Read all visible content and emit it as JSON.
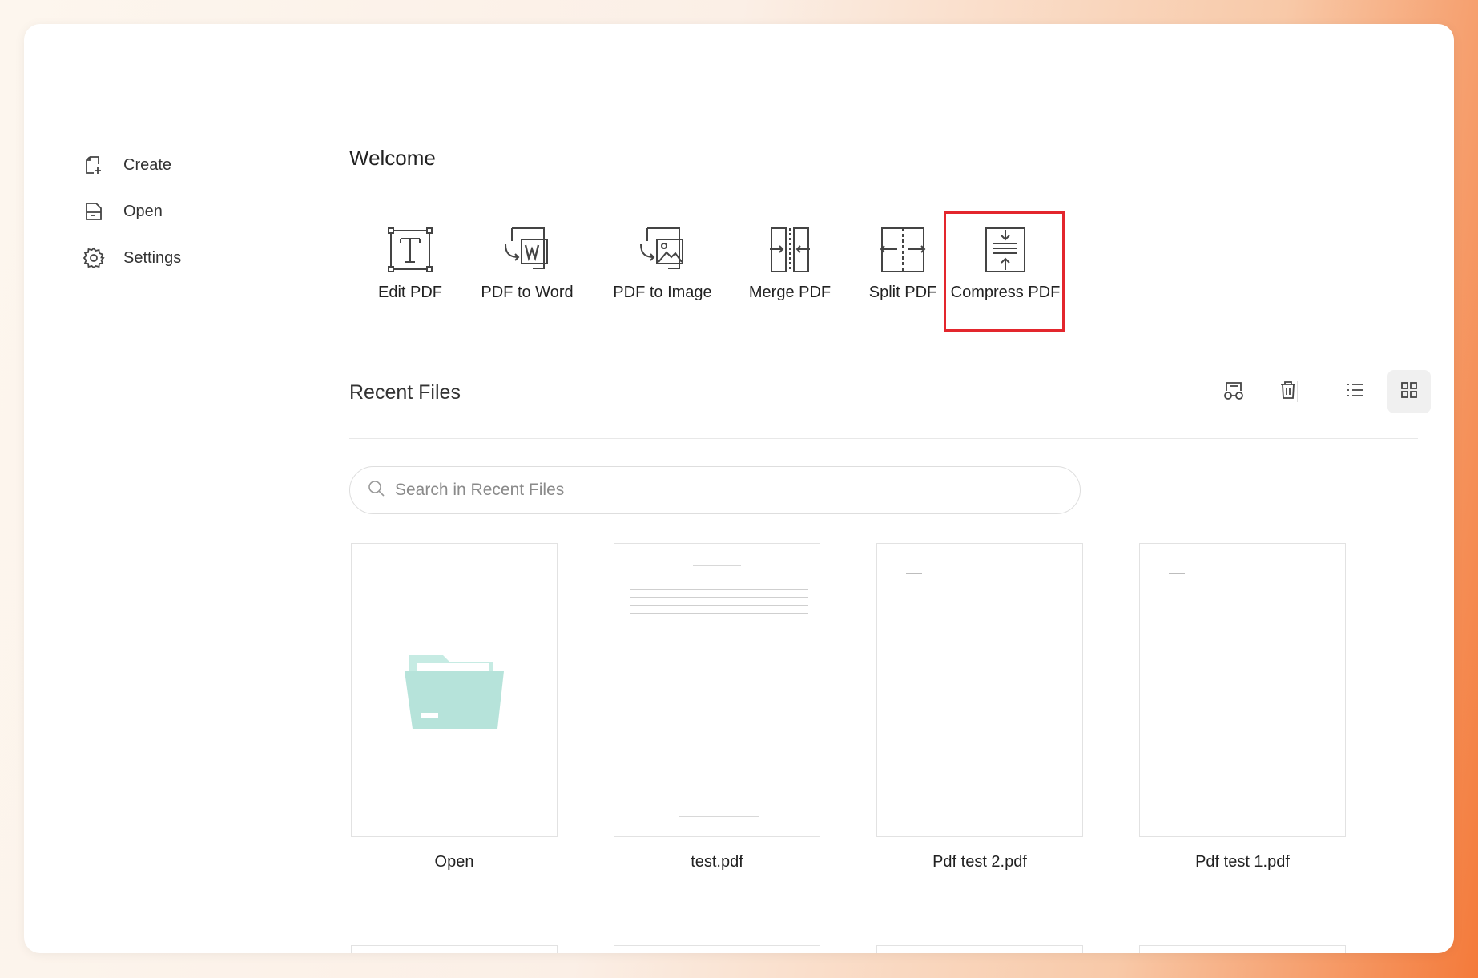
{
  "sidebar": {
    "items": [
      {
        "label": "Create",
        "icon": "create-file-icon"
      },
      {
        "label": "Open",
        "icon": "open-file-icon"
      },
      {
        "label": "Settings",
        "icon": "gear-icon"
      }
    ]
  },
  "main": {
    "welcome_title": "Welcome",
    "tools": [
      {
        "label": "Edit PDF",
        "icon": "edit-pdf-icon"
      },
      {
        "label": "PDF to Word",
        "icon": "pdf-to-word-icon"
      },
      {
        "label": "PDF to Image",
        "icon": "pdf-to-image-icon"
      },
      {
        "label": "Merge PDF",
        "icon": "merge-pdf-icon"
      },
      {
        "label": "Split PDF",
        "icon": "split-pdf-icon"
      },
      {
        "label": "Compress PDF",
        "icon": "compress-pdf-icon"
      }
    ],
    "highlighted_tool": "Compress PDF",
    "highlight_color": "#e3262d",
    "recent_files": {
      "title": "Recent Files",
      "toolbar_icons": [
        "clean-recent-icon",
        "trash-icon",
        "list-view-icon",
        "grid-view-icon"
      ],
      "active_view": "grid",
      "search_placeholder": "Search in Recent Files",
      "search_value": "",
      "files": [
        {
          "name": "Open",
          "icon": "folder-icon"
        },
        {
          "name": "test.pdf"
        },
        {
          "name": "Pdf test 2.pdf"
        },
        {
          "name": "Pdf test 1.pdf"
        }
      ]
    }
  },
  "colors": {
    "folder_icon": "#b6e3da",
    "scrollbar": "#f2a8a8"
  }
}
